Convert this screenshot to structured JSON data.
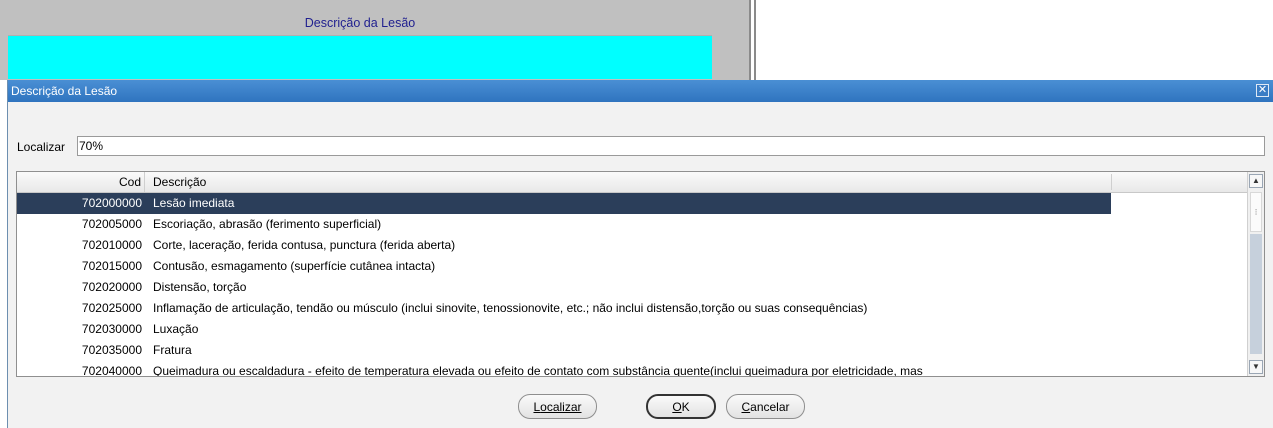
{
  "background_form": {
    "column_header": "Descrição da Lesão"
  },
  "dialog": {
    "title": "Descrição da Lesão",
    "close_glyph": "✕",
    "find_label": "Localizar",
    "find_value": "70%",
    "columns": {
      "cod": "Cod",
      "desc": "Descrição"
    },
    "rows": [
      {
        "cod": "702000000",
        "desc": "Lesão imediata",
        "selected": true
      },
      {
        "cod": "702005000",
        "desc": "Escoriação, abrasão (ferimento superficial)"
      },
      {
        "cod": "702010000",
        "desc": "Corte, laceração, ferida contusa, punctura (ferida aberta)"
      },
      {
        "cod": "702015000",
        "desc": "Contusão, esmagamento (superfície cutânea intacta)"
      },
      {
        "cod": "702020000",
        "desc": "Distensão, torção"
      },
      {
        "cod": "702025000",
        "desc": "Inflamação de articulação, tendão ou músculo (inclui sinovite, tenossionovite, etc.; não inclui distensão,torção ou suas consequências)"
      },
      {
        "cod": "702030000",
        "desc": "Luxação"
      },
      {
        "cod": "702035000",
        "desc": "Fratura"
      },
      {
        "cod": "702040000",
        "desc": "Queimadura ou escaldadura - efeito de temperatura elevada ou efeito de contato com substância quente(inclui queimadura por eletricidade, mas"
      }
    ],
    "buttons": {
      "find": {
        "prefix": "",
        "underline": "L",
        "rest": "ocalizar"
      },
      "ok": {
        "prefix": "",
        "underline": "O",
        "rest": "K"
      },
      "cancel": {
        "prefix": "",
        "underline": "C",
        "rest": "ancelar"
      }
    }
  },
  "colors": {
    "title_bar": "#2f74bf",
    "selection": "#2b3e5a",
    "cyan_field": "#00ffff"
  }
}
